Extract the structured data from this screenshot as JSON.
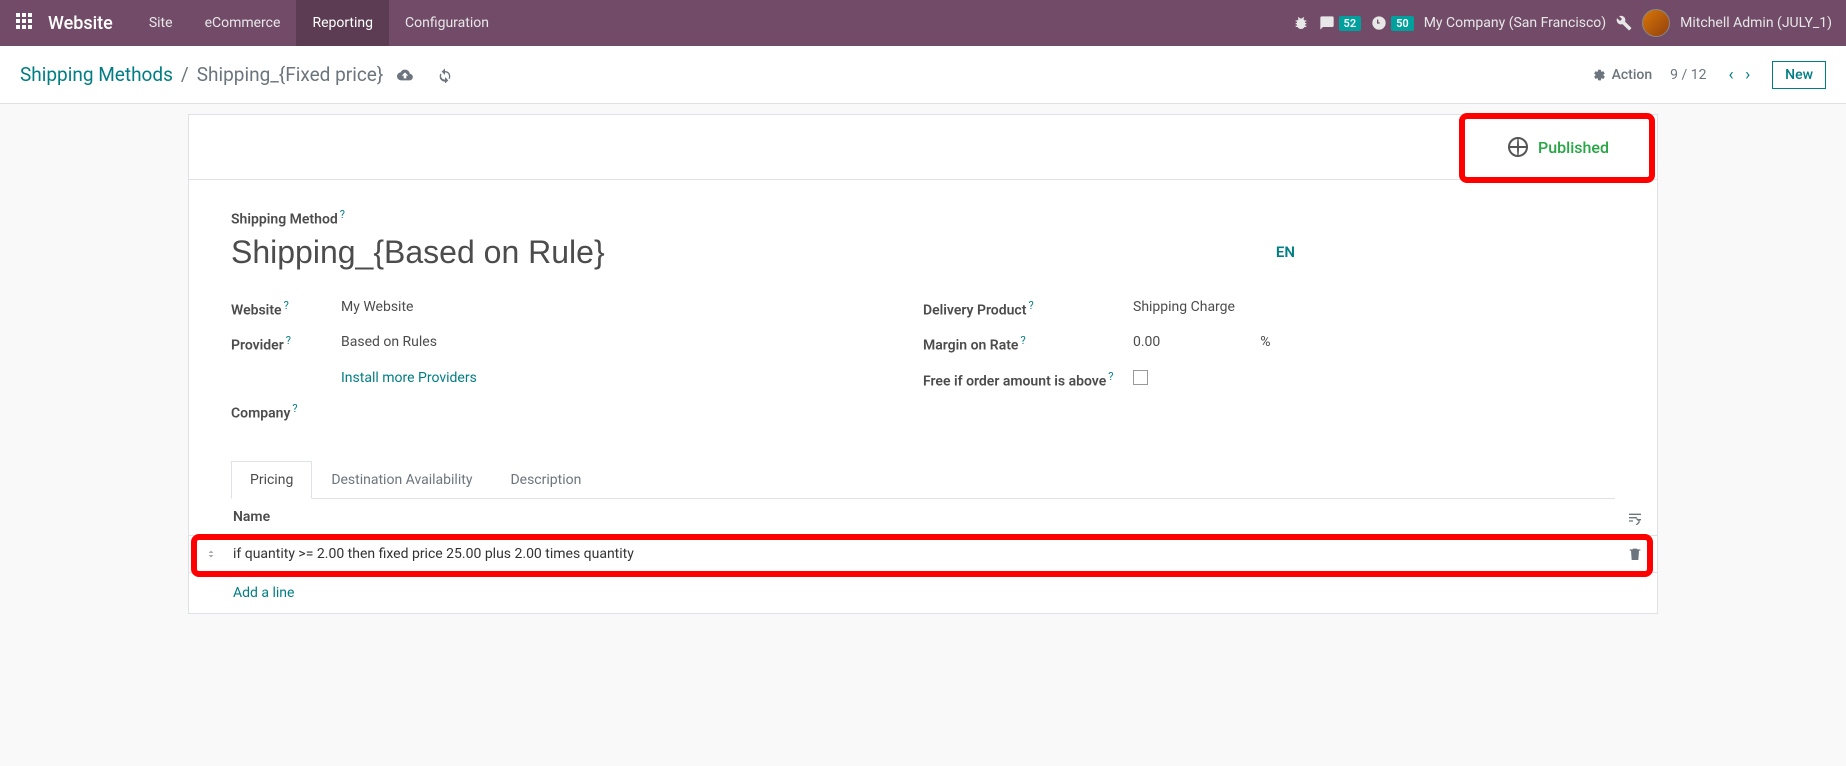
{
  "topbar": {
    "app_name": "Website",
    "menu": [
      "Site",
      "eCommerce",
      "Reporting",
      "Configuration"
    ],
    "active_menu_index": 2,
    "chat_badge": "52",
    "clock_badge": "50",
    "company": "My Company (San Francisco)",
    "user": "Mitchell Admin (JULY_1)"
  },
  "breadcrumb": {
    "root": "Shipping Methods",
    "sep": "/",
    "current": "Shipping_{Fixed price}"
  },
  "controlbar": {
    "action": "Action",
    "pager": "9 / 12",
    "new": "New"
  },
  "status": {
    "published": "Published"
  },
  "form": {
    "shipping_method_label": "Shipping Method",
    "name": "Shipping_{Based on Rule}",
    "lang": "EN",
    "left": {
      "website_label": "Website",
      "website_value": "My Website",
      "provider_label": "Provider",
      "provider_value": "Based on Rules",
      "install_more": "Install more Providers",
      "company_label": "Company"
    },
    "right": {
      "delivery_product_label": "Delivery Product",
      "delivery_product_value": "Shipping Charge",
      "margin_label": "Margin on Rate",
      "margin_value": "0.00",
      "margin_unit": "%",
      "free_label": "Free if order amount is above"
    }
  },
  "tabs": {
    "items": [
      "Pricing",
      "Destination Availability",
      "Description"
    ],
    "active_index": 0
  },
  "pricing_table": {
    "header": "Name",
    "rows": [
      "if quantity >= 2.00 then fixed price 25.00 plus 2.00 times quantity"
    ],
    "add_line": "Add a line"
  }
}
